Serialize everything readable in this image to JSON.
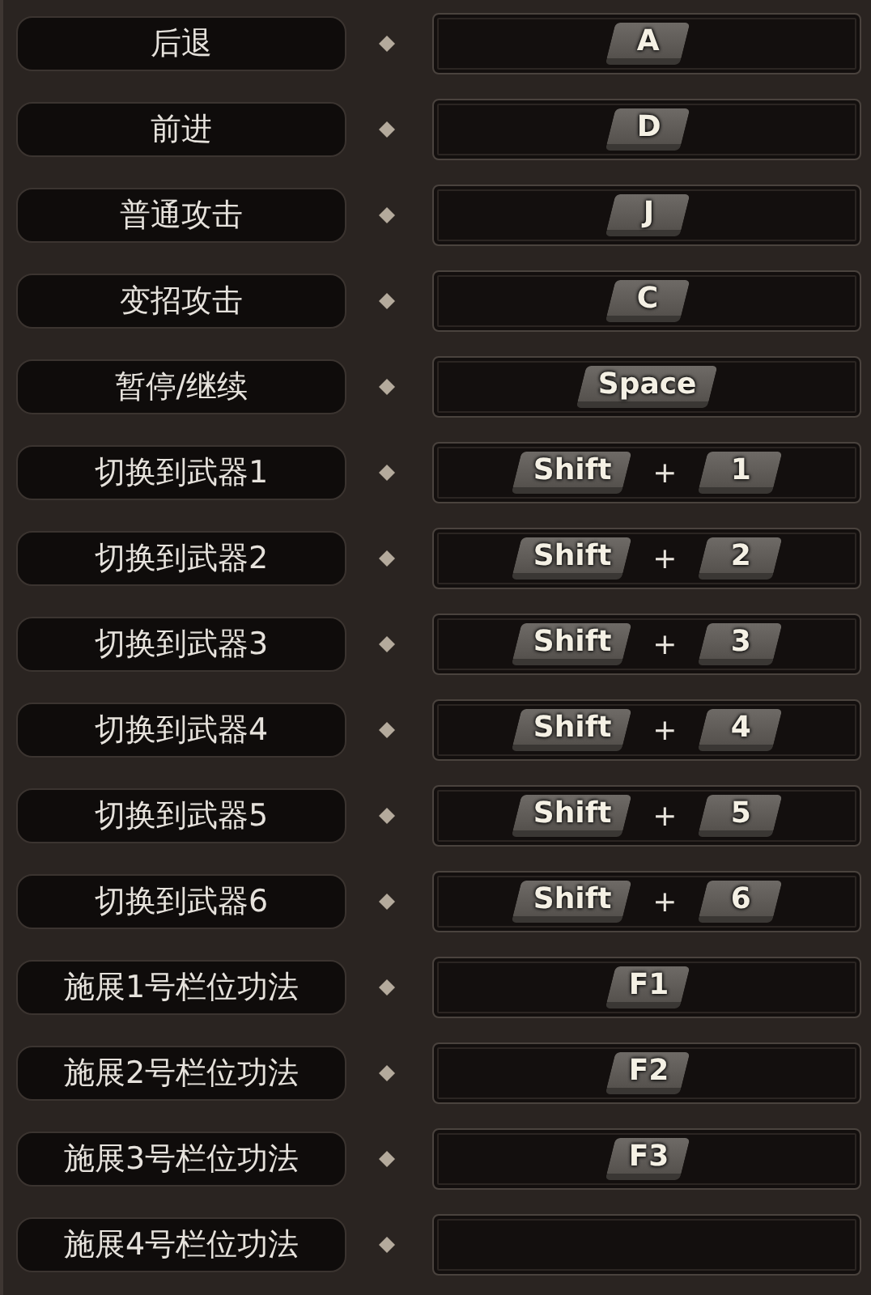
{
  "bindings": [
    {
      "action": "后退",
      "keys": [
        {
          "kind": "key",
          "label": "A"
        }
      ]
    },
    {
      "action": "前进",
      "keys": [
        {
          "kind": "key",
          "label": "D"
        }
      ]
    },
    {
      "action": "普通攻击",
      "keys": [
        {
          "kind": "key",
          "label": "J"
        }
      ]
    },
    {
      "action": "变招攻击",
      "keys": [
        {
          "kind": "key",
          "label": "C"
        }
      ]
    },
    {
      "action": "暂停/继续",
      "keys": [
        {
          "kind": "key",
          "label": "Space"
        }
      ]
    },
    {
      "action": "切换到武器1",
      "keys": [
        {
          "kind": "key",
          "label": "Shift"
        },
        {
          "kind": "plus",
          "label": "+"
        },
        {
          "kind": "key",
          "label": "1"
        }
      ]
    },
    {
      "action": "切换到武器2",
      "keys": [
        {
          "kind": "key",
          "label": "Shift"
        },
        {
          "kind": "plus",
          "label": "+"
        },
        {
          "kind": "key",
          "label": "2"
        }
      ]
    },
    {
      "action": "切换到武器3",
      "keys": [
        {
          "kind": "key",
          "label": "Shift"
        },
        {
          "kind": "plus",
          "label": "+"
        },
        {
          "kind": "key",
          "label": "3"
        }
      ]
    },
    {
      "action": "切换到武器4",
      "keys": [
        {
          "kind": "key",
          "label": "Shift"
        },
        {
          "kind": "plus",
          "label": "+"
        },
        {
          "kind": "key",
          "label": "4"
        }
      ]
    },
    {
      "action": "切换到武器5",
      "keys": [
        {
          "kind": "key",
          "label": "Shift"
        },
        {
          "kind": "plus",
          "label": "+"
        },
        {
          "kind": "key",
          "label": "5"
        }
      ]
    },
    {
      "action": "切换到武器6",
      "keys": [
        {
          "kind": "key",
          "label": "Shift"
        },
        {
          "kind": "plus",
          "label": "+"
        },
        {
          "kind": "key",
          "label": "6"
        }
      ]
    },
    {
      "action": "施展1号栏位功法",
      "keys": [
        {
          "kind": "key",
          "label": "F1"
        }
      ]
    },
    {
      "action": "施展2号栏位功法",
      "keys": [
        {
          "kind": "key",
          "label": "F2"
        }
      ]
    },
    {
      "action": "施展3号栏位功法",
      "keys": [
        {
          "kind": "key",
          "label": "F3"
        }
      ]
    },
    {
      "action": "施展4号栏位功法"
    }
  ]
}
